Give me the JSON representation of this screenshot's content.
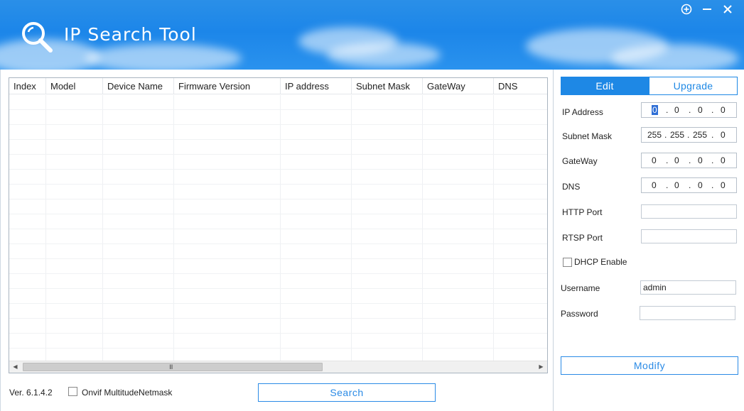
{
  "app": {
    "title": "IP Search Tool",
    "accent_color": "#1e88e5"
  },
  "window_controls": {
    "icons": [
      "add-circle-icon",
      "minimize-icon",
      "close-icon"
    ]
  },
  "table": {
    "columns": [
      "Index",
      "Model",
      "Device Name",
      "Firmware Version",
      "IP address",
      "Subnet Mask",
      "GateWay",
      "DNS"
    ],
    "rows": [],
    "scrollbar_grip": "III"
  },
  "footer": {
    "version": "Ver. 6.1.4.2",
    "onvif_label": "Onvif MultitudeNetmask",
    "onvif_checked": false,
    "search_label": "Search"
  },
  "edit_panel": {
    "tabs": [
      "Edit",
      "Upgrade"
    ],
    "active_tab": "Edit",
    "ip_address_label": "IP Address",
    "ip_address": [
      "0",
      "0",
      "0",
      "0"
    ],
    "subnet_mask_label": "Subnet Mask",
    "subnet_mask": [
      "255",
      "255",
      "255",
      "0"
    ],
    "gateway_label": "GateWay",
    "gateway": [
      "0",
      "0",
      "0",
      "0"
    ],
    "dns_label": "DNS",
    "dns": [
      "0",
      "0",
      "0",
      "0"
    ],
    "http_port_label": "HTTP Port",
    "http_port": "",
    "rtsp_port_label": "RTSP Port",
    "rtsp_port": "",
    "dhcp_label": "DHCP Enable",
    "dhcp_checked": false,
    "username_label": "Username",
    "username": "admin",
    "password_label": "Password",
    "password": "",
    "modify_label": "Modify"
  }
}
